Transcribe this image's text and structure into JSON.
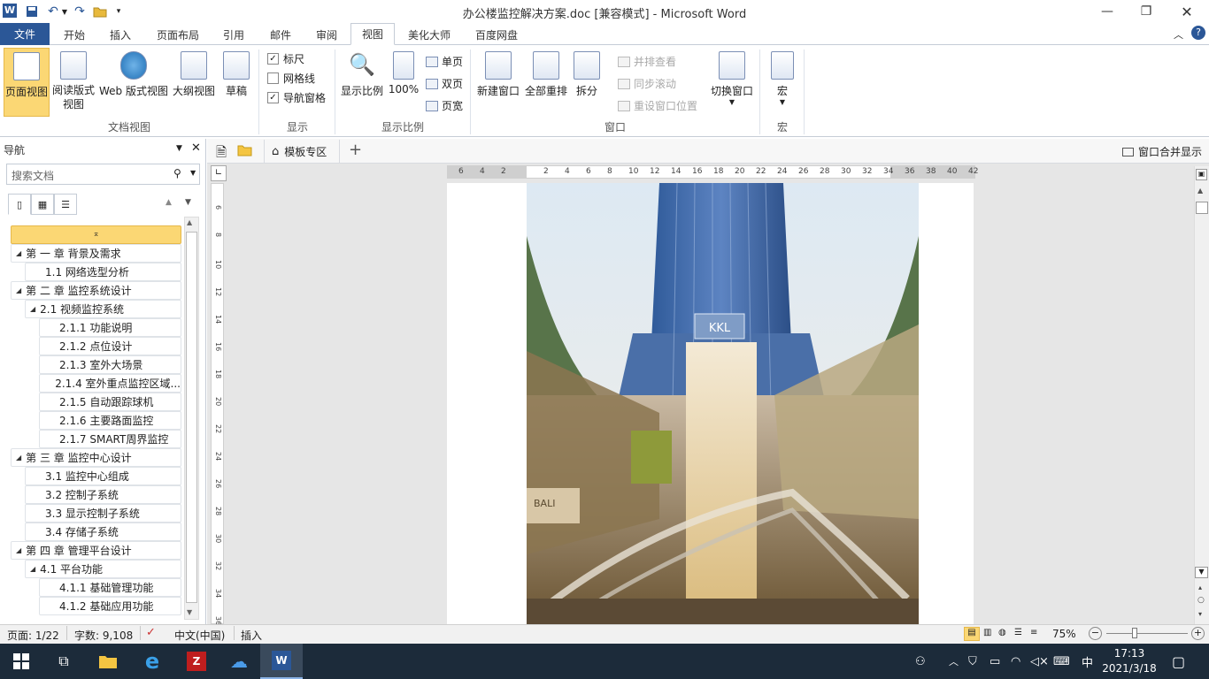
{
  "title_bar": {
    "title": "办公楼监控解决方案.doc [兼容模式]  -  Microsoft Word",
    "app_icon": "word-icon",
    "quick_access": [
      "save-icon",
      "undo-icon",
      "redo-icon",
      "open-icon",
      "customize-icon"
    ],
    "window_controls": {
      "minimize": "—",
      "restore": "❐",
      "close": "✕"
    }
  },
  "ribbon_tabs": [
    "文件",
    "开始",
    "插入",
    "页面布局",
    "引用",
    "邮件",
    "审阅",
    "视图",
    "美化大师",
    "百度网盘"
  ],
  "active_tab": "视图",
  "ribbon": {
    "doc_views": {
      "group_label": "文档视图",
      "buttons": [
        "页面视图",
        "阅读版式\n视图",
        "Web 版式视图",
        "大纲视图",
        "草稿"
      ]
    },
    "show": {
      "group_label": "显示",
      "checkboxes": [
        {
          "label": "标尺",
          "checked": true
        },
        {
          "label": "网格线",
          "checked": false
        },
        {
          "label": "导航窗格",
          "checked": true
        }
      ]
    },
    "zoom": {
      "group_label": "显示比例",
      "zoom_btn": "显示比例",
      "pct_btn": "100%",
      "small": [
        "单页",
        "双页",
        "页宽"
      ]
    },
    "window": {
      "group_label": "窗口",
      "buttons": [
        "新建窗口",
        "全部重排",
        "拆分"
      ],
      "small": [
        "并排查看",
        "同步滚动",
        "重设窗口位置"
      ],
      "switch": "切换窗口"
    },
    "macro": {
      "group_label": "宏",
      "button": "宏"
    }
  },
  "nav_pane": {
    "title": "导航",
    "search_placeholder": "搜索文档",
    "items": [
      {
        "text": "第 一 章  背景及需求",
        "level": 1,
        "expanded": true
      },
      {
        "text": "1.1 网络选型分析",
        "level": 2,
        "expanded": null
      },
      {
        "text": "第 二 章  监控系统设计",
        "level": 1,
        "expanded": true
      },
      {
        "text": "2.1 视频监控系统",
        "level": 2,
        "expanded": true
      },
      {
        "text": "2.1.1 功能说明",
        "level": 3,
        "expanded": null
      },
      {
        "text": "2.1.2 点位设计",
        "level": 3,
        "expanded": null
      },
      {
        "text": "2.1.3 室外大场景",
        "level": 3,
        "expanded": null
      },
      {
        "text": "2.1.4 室外重点监控区域...",
        "level": 3,
        "expanded": null
      },
      {
        "text": "2.1.5 自动跟踪球机",
        "level": 3,
        "expanded": null
      },
      {
        "text": "2.1.6 主要路面监控",
        "level": 3,
        "expanded": null
      },
      {
        "text": "2.1.7 SMART周界监控",
        "level": 3,
        "expanded": null
      },
      {
        "text": "第 三 章  监控中心设计",
        "level": 1,
        "expanded": true
      },
      {
        "text": "3.1 监控中心组成",
        "level": 2,
        "expanded": null
      },
      {
        "text": "3.2 控制子系统",
        "level": 2,
        "expanded": null
      },
      {
        "text": "3.3 显示控制子系统",
        "level": 2,
        "expanded": null
      },
      {
        "text": "3.4 存储子系统",
        "level": 2,
        "expanded": null
      },
      {
        "text": "第 四 章  管理平台设计",
        "level": 1,
        "expanded": true
      },
      {
        "text": "4.1 平台功能",
        "level": 2,
        "expanded": true
      },
      {
        "text": "4.1.1 基础管理功能",
        "level": 3,
        "expanded": null
      },
      {
        "text": "4.1.2 基础应用功能",
        "level": 3,
        "expanded": null
      }
    ]
  },
  "doc_tabs": {
    "template_zone": "模板专区",
    "merge": "窗口合并显示"
  },
  "ruler_labels": [
    "6",
    "4",
    "2",
    "",
    "2",
    "4",
    "6",
    "8",
    "10",
    "12",
    "14",
    "16",
    "18",
    "20",
    "22",
    "24",
    "26",
    "28",
    "30",
    "32",
    "34",
    "36",
    "38",
    "40",
    "42"
  ],
  "vruler_labels": [
    "6",
    "8",
    "10",
    "12",
    "14",
    "16",
    "18",
    "20",
    "22",
    "24",
    "26",
    "28",
    "30",
    "32",
    "34",
    "36"
  ],
  "photo_sign": "KKL",
  "photo_store": "BALI",
  "status": {
    "page": "页面: 1/22",
    "words": "字数: 9,108",
    "lang": "中文(中国)",
    "mode": "插入",
    "zoom": "75%"
  },
  "taskbar": {
    "time": "17:13",
    "date": "2021/3/18",
    "ime": "中"
  },
  "colors": {
    "file_tab": "#2b5797",
    "selected_btn": "#fbd774",
    "taskbar": "#1c2b3a"
  }
}
